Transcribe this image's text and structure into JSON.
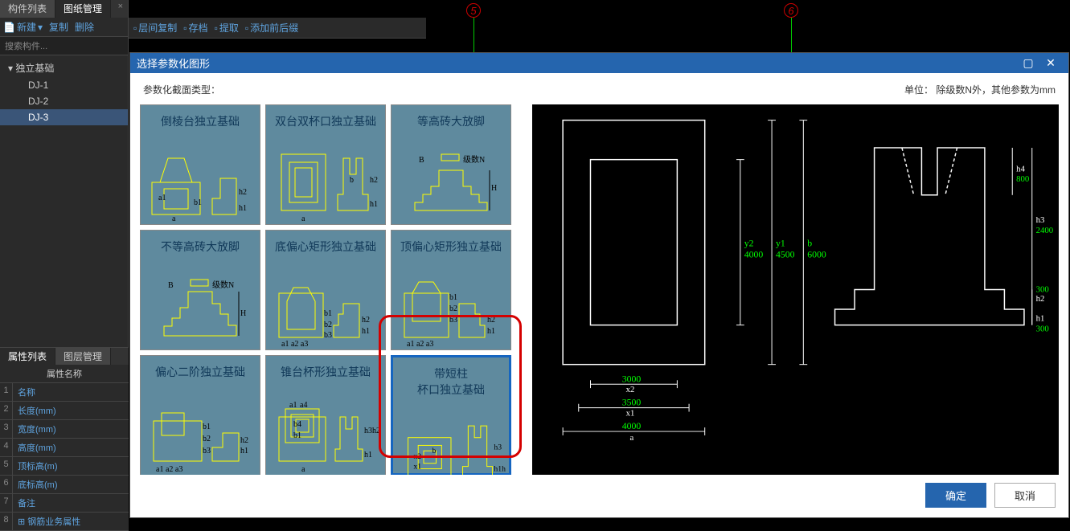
{
  "tabs": {
    "component_list": "构件列表",
    "drawing_mgmt": "图纸管理"
  },
  "toolbar": {
    "new": "新建",
    "copy": "复制",
    "delete": "删除",
    "layer_copy": "层间复制",
    "archive": "存档",
    "extract": "提取",
    "add_prefix": "添加前后缀"
  },
  "search_placeholder": "搜索构件...",
  "tree": {
    "root": "独立基础",
    "items": [
      "DJ-1",
      "DJ-2",
      "DJ-3"
    ],
    "selected": 2
  },
  "prop_tabs": {
    "prop_list": "属性列表",
    "layer_mgmt": "图层管理"
  },
  "prop_header": "属性名称",
  "props": [
    {
      "n": "1",
      "name": "名称"
    },
    {
      "n": "2",
      "name": "长度(mm)"
    },
    {
      "n": "3",
      "name": "宽度(mm)"
    },
    {
      "n": "4",
      "name": "高度(mm)"
    },
    {
      "n": "5",
      "name": "顶标高(m)"
    },
    {
      "n": "6",
      "name": "底标高(m)"
    },
    {
      "n": "7",
      "name": "备注"
    },
    {
      "n": "8",
      "name": "钢筋业务属性",
      "expand": true
    }
  ],
  "axes": {
    "a5": "5",
    "a6": "6"
  },
  "dialog": {
    "title": "选择参数化图形",
    "section_label": "参数化截面类型：",
    "unit_label": "单位：  除级数N外，其他参数为mm",
    "ok": "确定",
    "cancel": "取消"
  },
  "templates": [
    {
      "id": "t1",
      "label": "倒棱台独立基础"
    },
    {
      "id": "t2",
      "label": "双台双杯口独立基础"
    },
    {
      "id": "t3",
      "label": "等高砖大放脚"
    },
    {
      "id": "t4",
      "label": "不等高砖大放脚"
    },
    {
      "id": "t5",
      "label": "底偏心矩形独立基础"
    },
    {
      "id": "t6",
      "label": "顶偏心矩形独立基础"
    },
    {
      "id": "t7",
      "label": "偏心二阶独立基础"
    },
    {
      "id": "t8",
      "label": "锥台杯形独立基础"
    },
    {
      "id": "t9",
      "label": "带短柱\n杯口独立基础",
      "selected": true
    }
  ],
  "preview_dims": {
    "x2": "3000",
    "x1": "3500",
    "a": "4000",
    "y2": "4000",
    "y1": "4500",
    "b": "6000",
    "h1": "300",
    "h2": "300",
    "h3": "2400",
    "h4": "800"
  }
}
